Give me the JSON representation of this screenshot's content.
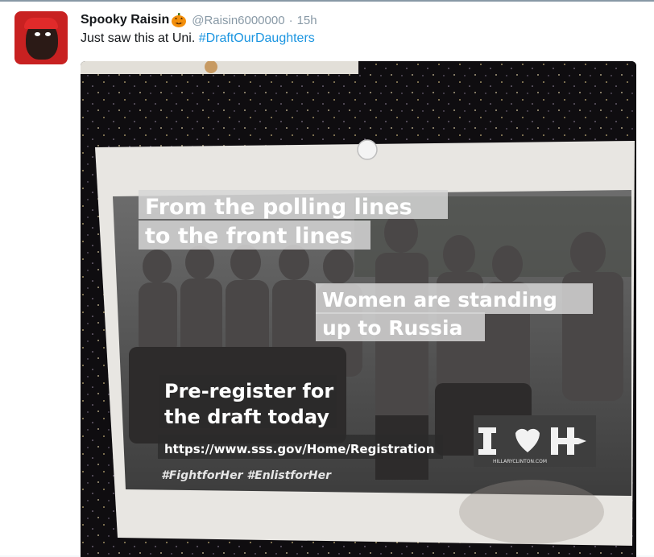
{
  "tweet": {
    "author_name": "Spooky Raisin",
    "handle": "@Raisin6000000",
    "separator": "·",
    "time": "15h",
    "text_prefix": "Just saw this at Uni. ",
    "hashtag": "#DraftOurDaughters",
    "avatar_icon": "user-avatar",
    "emoji_icon": "jack-o-lantern-icon"
  },
  "poster": {
    "headline_line1": "From the polling lines",
    "headline_line2": "to the front lines",
    "middle_line1": "Women are standing",
    "middle_line2": "up to Russia",
    "cta_line1": "Pre-register for",
    "cta_line2": "the draft today",
    "url": "https://www.sss.gov/Home/Registration",
    "hashtags": "#FightforHer #EnlistforHer",
    "logo_site": "HILLARYCLINTON.COM",
    "logo_icon": "hillary-h-logo"
  },
  "colors": {
    "link": "#1b95e0",
    "muted": "#8899a6",
    "text": "#14171a",
    "avatar_bg": "#c82121",
    "pumpkin": "#f4900c"
  }
}
